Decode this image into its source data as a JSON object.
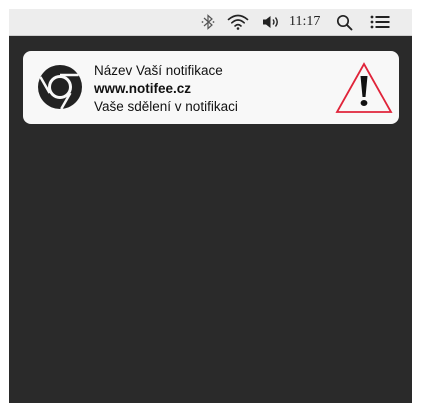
{
  "menubar": {
    "icons": [
      "bluetooth-icon",
      "wifi-icon",
      "volume-icon",
      "search-icon",
      "notification-center-icon"
    ],
    "time": "11:17"
  },
  "notification": {
    "app_icon": "chrome-icon",
    "title": "Název Vaší notifikace",
    "site": "www.notifee.cz",
    "message": "Vaše sdělení v notifikaci",
    "badge_icon": "warning-icon",
    "colors": {
      "warning_stroke": "#e0243a",
      "logo": "#222222"
    }
  }
}
